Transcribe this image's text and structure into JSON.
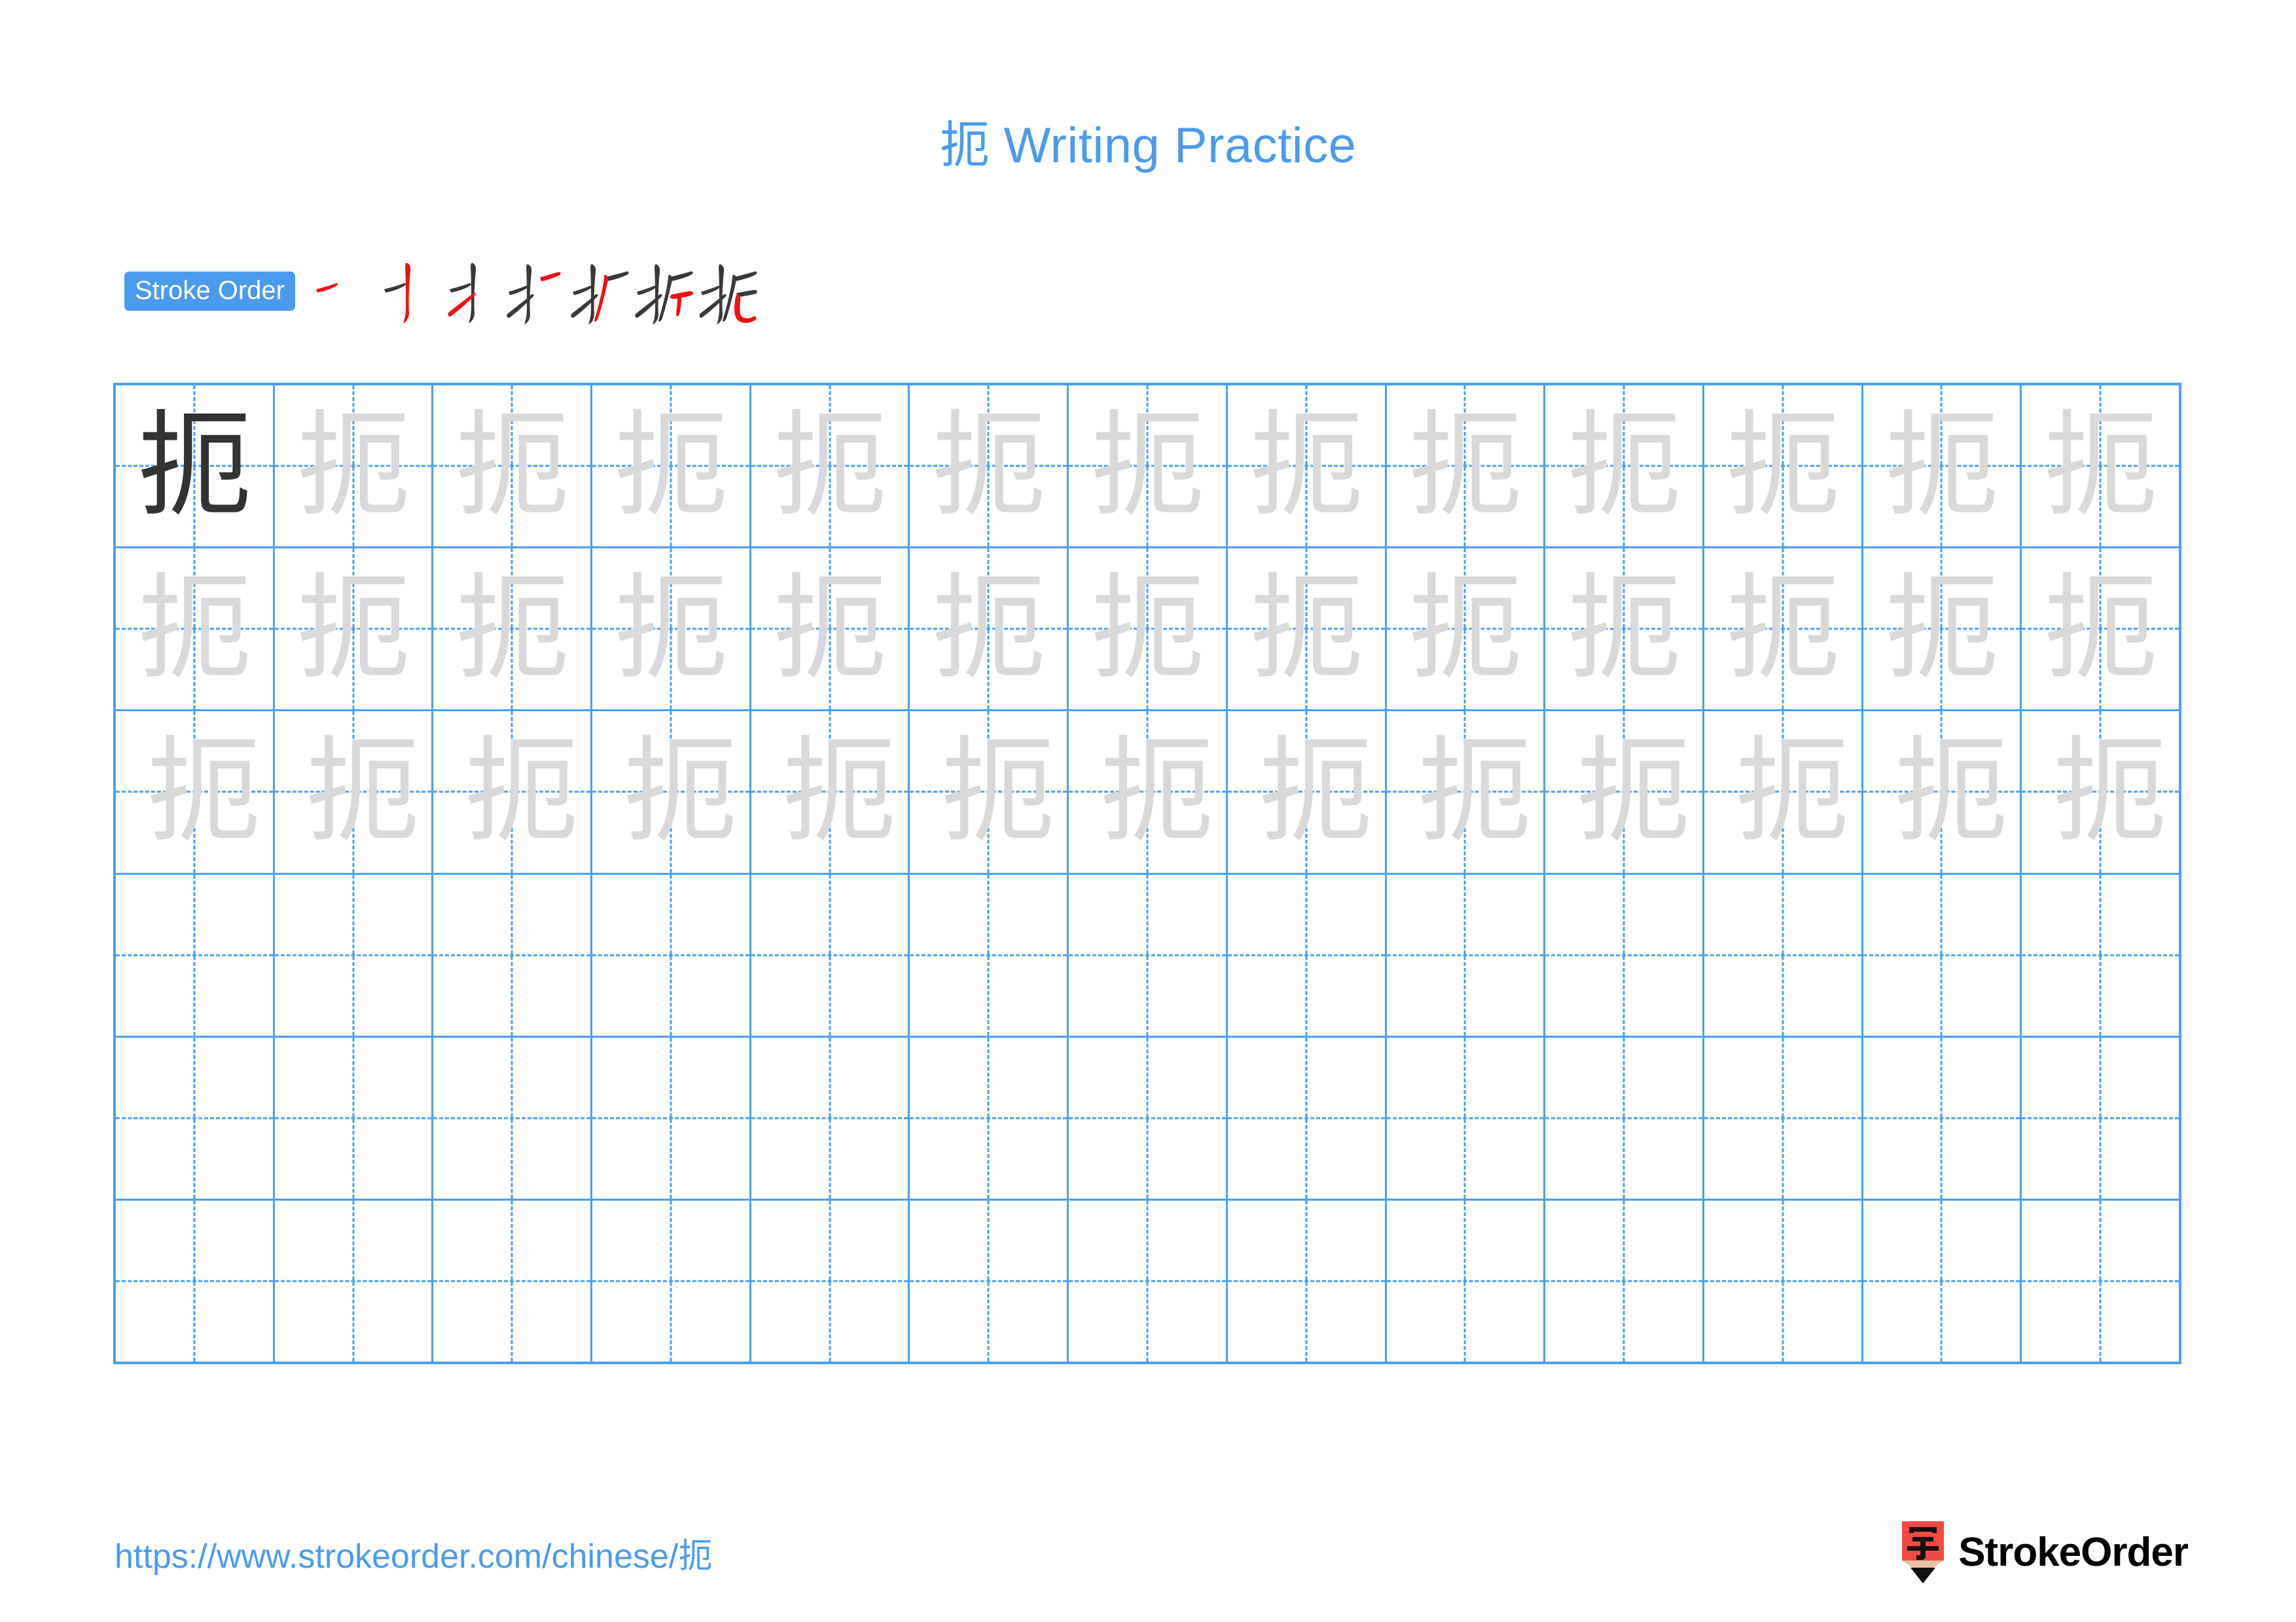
{
  "page": {
    "character": "扼",
    "title": "扼 Writing Practice",
    "background_color": "#ffffff"
  },
  "stroke_order": {
    "badge_label": "Stroke Order",
    "badge_color": "#4a9bee",
    "new_stroke_color": "#ee1111",
    "prior_stroke_color": "#3a3a3a",
    "total_strokes": 7,
    "steps": [
      {
        "index": 1,
        "cumulative": "一",
        "new_stroke": "héng (horizontal)"
      },
      {
        "index": 2,
        "cumulative": "十",
        "new_stroke": "shù-gōu (vertical hook)"
      },
      {
        "index": 3,
        "cumulative": "扌",
        "new_stroke": "tí (rising)"
      },
      {
        "index": 4,
        "cumulative": "扌一",
        "new_stroke": "héng (horizontal)"
      },
      {
        "index": 5,
        "cumulative": "扩",
        "new_stroke": "piě (left-falling)"
      },
      {
        "index": 6,
        "cumulative": "折",
        "new_stroke": "héng-zhé (horizontal turn)"
      },
      {
        "index": 7,
        "cumulative": "扼",
        "new_stroke": "shù-wān-gōu (vertical bend hook)"
      }
    ]
  },
  "grid": {
    "columns": 13,
    "rows": 6,
    "line_color": "#4a9ff0",
    "guide_color": "#4a9ff0",
    "model_char_color": "#333333",
    "trace_char_color": "#d9d9d9",
    "row_contents": [
      {
        "row": 1,
        "model_cells": 1,
        "trace_cells": 12,
        "empty_cells": 0
      },
      {
        "row": 2,
        "model_cells": 0,
        "trace_cells": 13,
        "empty_cells": 0
      },
      {
        "row": 3,
        "model_cells": 0,
        "trace_cells": 13,
        "empty_cells": 0
      },
      {
        "row": 4,
        "model_cells": 0,
        "trace_cells": 0,
        "empty_cells": 13
      },
      {
        "row": 5,
        "model_cells": 0,
        "trace_cells": 0,
        "empty_cells": 13
      },
      {
        "row": 6,
        "model_cells": 0,
        "trace_cells": 0,
        "empty_cells": 13
      }
    ]
  },
  "footer": {
    "url": "https://www.strokeorder.com/chinese/扼",
    "url_color": "#4a9bee",
    "brand_name": "StrokeOrder",
    "logo": {
      "icon_character": "字",
      "body_color": "#f04a43",
      "wood_color": "#e8c39e",
      "tip_color": "#111111"
    }
  }
}
